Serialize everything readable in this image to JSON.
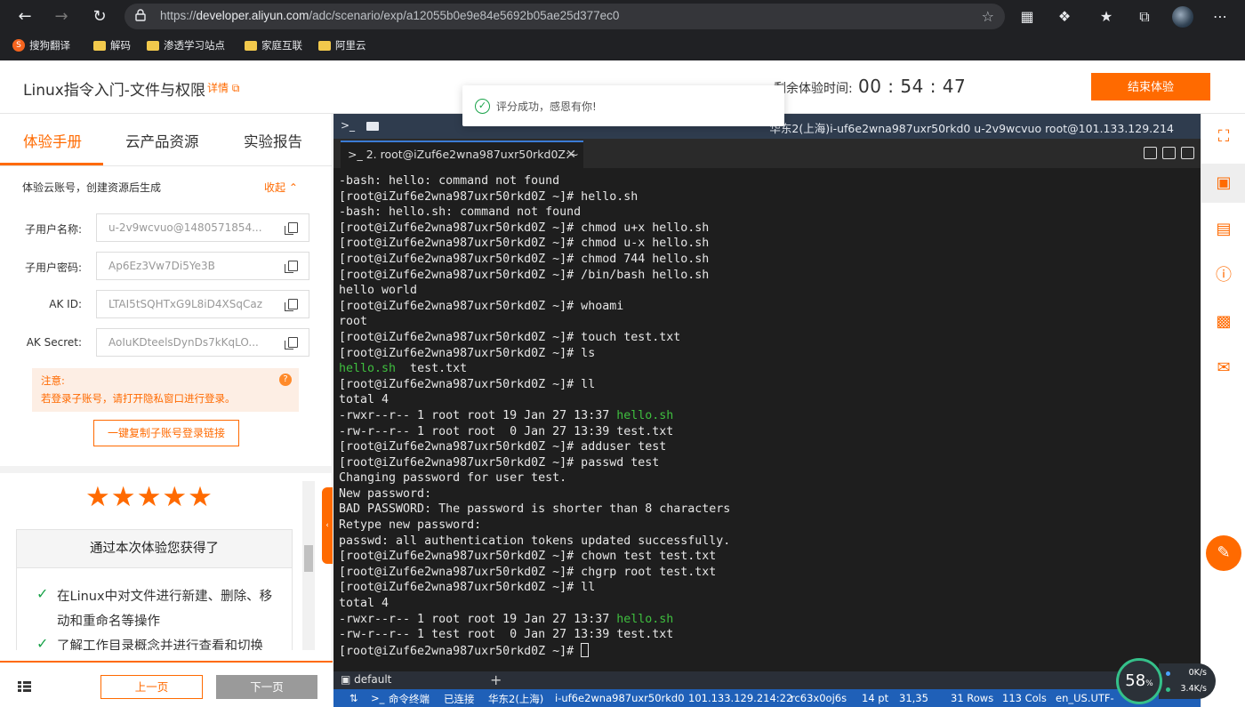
{
  "browser": {
    "url_prefix": "https://",
    "url_host": "developer.aliyun.com",
    "url_path": "/adc/scenario/exp/a12055b0e9e84e5692b05ae25d377ec0",
    "bookmarks": [
      "搜狗翻译",
      "解码",
      "渗透学习站点",
      "家庭互联",
      "阿里云"
    ]
  },
  "header": {
    "title": "Linux指令入门-文件与权限",
    "detail": "详情",
    "timer_label": "剩余体验时间:",
    "timer": "00 : 54 : 47",
    "end_button": "结束体验",
    "toast": "评分成功，感恩有你!"
  },
  "left": {
    "tabs": [
      "体验手册",
      "云产品资源",
      "实验报告"
    ],
    "account_note": "体验云账号，创建资源后生成",
    "collapse": "收起",
    "fields": [
      {
        "label": "子用户名称:",
        "value": "u-2v9wcvuo@1480571854..."
      },
      {
        "label": "子用户密码:",
        "value": "Ap6Ez3Vw7Di5Ye3B"
      },
      {
        "label": "AK ID:",
        "value": "LTAI5tSQHTxG9L8iD4XSqCaz"
      },
      {
        "label": "AK Secret:",
        "value": "AoIuKDteelsDynDs7kKqLO..."
      }
    ],
    "notice_title": "注意:",
    "notice_body": "若登录子账号，请打开隐私窗口进行登录。",
    "copy_button": "一键复制子账号登录链接",
    "reward_title": "通过本次体验您获得了",
    "reward_items": [
      "在Linux中对文件进行新建、删除、移动和重命名等操作",
      "了解工作目录概念并进行查看和切换"
    ],
    "prev": "上一页",
    "next": "下一页"
  },
  "terminal": {
    "top_info": "华东2(上海)i-uf6e2wna987uxr50rkd0   u-2v9wcvuo   root@101.133.129.214",
    "tab_title": "2. root@iZuf6e2wna987uxr50rkd0Z:~",
    "lines": [
      "-bash: hello: command not found",
      "[root@iZuf6e2wna987uxr50rkd0Z ~]# hello.sh",
      "-bash: hello.sh: command not found",
      "[root@iZuf6e2wna987uxr50rkd0Z ~]# chmod u+x hello.sh",
      "[root@iZuf6e2wna987uxr50rkd0Z ~]# chmod u-x hello.sh",
      "[root@iZuf6e2wna987uxr50rkd0Z ~]# chmod 744 hello.sh",
      "[root@iZuf6e2wna987uxr50rkd0Z ~]# /bin/bash hello.sh",
      "hello world",
      "[root@iZuf6e2wna987uxr50rkd0Z ~]# whoami",
      "root",
      "[root@iZuf6e2wna987uxr50rkd0Z ~]# touch test.txt",
      "[root@iZuf6e2wna987uxr50rkd0Z ~]# ls",
      "@@hello.sh  test.txt",
      "[root@iZuf6e2wna987uxr50rkd0Z ~]# ll",
      "total 4",
      "-rwxr--r-- 1 root root 19 Jan 27 13:37 ##hello.sh",
      "-rw-r--r-- 1 root root  0 Jan 27 13:39 test.txt",
      "[root@iZuf6e2wna987uxr50rkd0Z ~]# adduser test",
      "[root@iZuf6e2wna987uxr50rkd0Z ~]# passwd test",
      "Changing password for user test.",
      "New password:",
      "BAD PASSWORD: The password is shorter than 8 characters",
      "Retype new password:",
      "passwd: all authentication tokens updated successfully.",
      "[root@iZuf6e2wna987uxr50rkd0Z ~]# chown test test.txt",
      "[root@iZuf6e2wna987uxr50rkd0Z ~]# chgrp root test.txt",
      "[root@iZuf6e2wna987uxr50rkd0Z ~]# ll",
      "total 4",
      "-rwxr--r-- 1 root root 19 Jan 27 13:37 ##hello.sh",
      "-rw-r--r-- 1 test root  0 Jan 27 13:39 test.txt",
      "[root@iZuf6e2wna987uxr50rkd0Z ~]# "
    ],
    "session": "default",
    "status": {
      "cmd": "命令终端",
      "conn": "已连接",
      "region": "华东2(上海)",
      "instance": "i-uf6e2wna987uxr50rkd0",
      "ip": "101.133.129.214:22",
      "sid": "rc63x0oj6s",
      "font": "14 pt",
      "pos": "31,35",
      "rows": "31 Rows",
      "cols": "113 Cols",
      "enc": "en_US.UTF-"
    }
  },
  "net": {
    "percent": "58",
    "pct_sign": "%",
    "up": "0K/s",
    "down": "3.4K/s"
  },
  "colors": {
    "accent": "#ff6a00",
    "terminal_bg": "#1e1e1e",
    "status_blue": "#1f60b8",
    "green": "#3fbf3f"
  }
}
